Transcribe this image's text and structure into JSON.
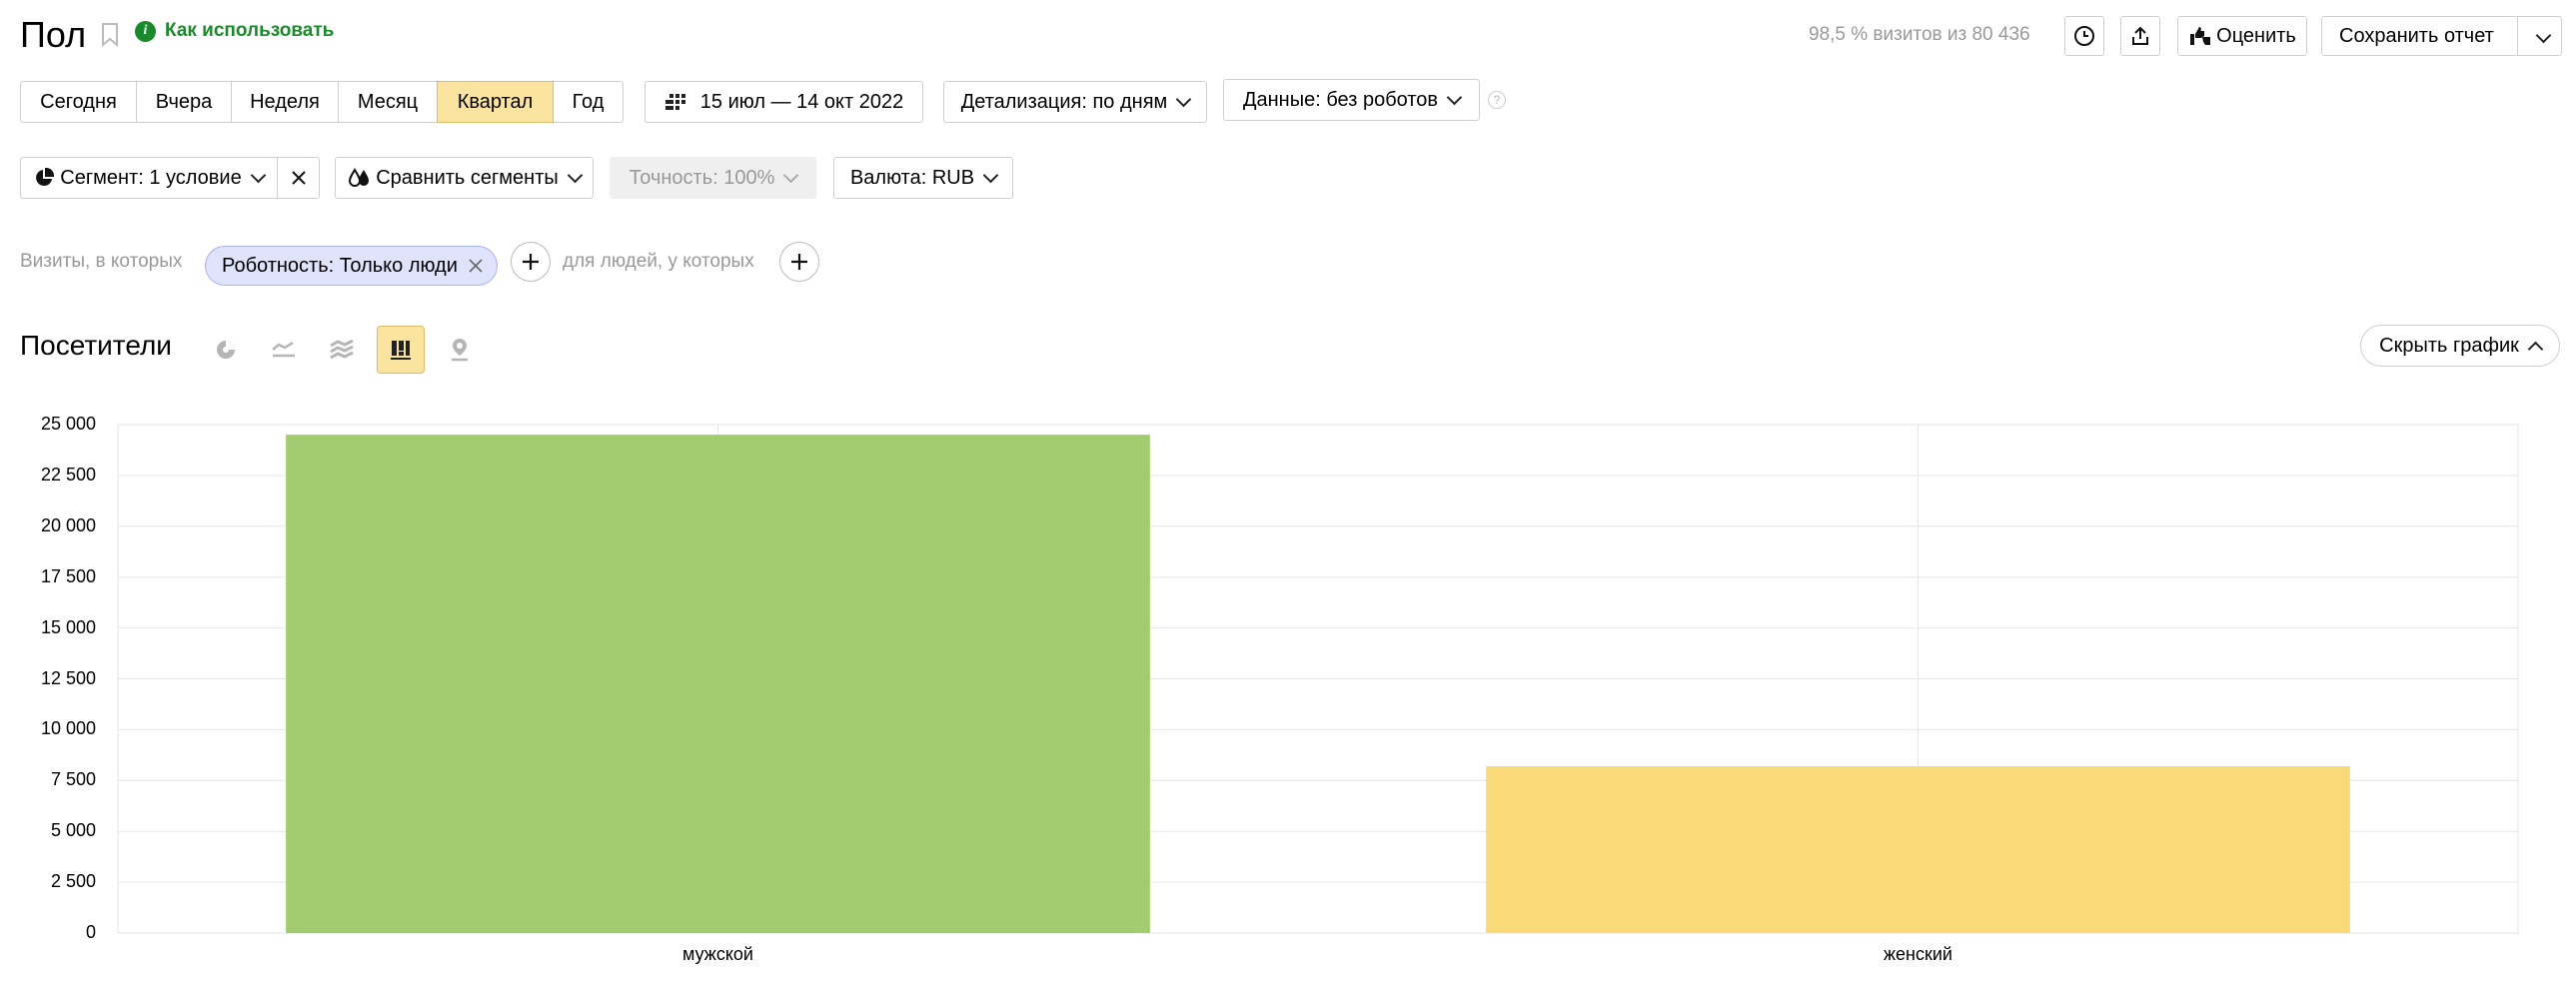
{
  "header": {
    "title": "Пол",
    "how_to_use": "Как использовать",
    "visits_info": "98,5 % визитов из 80 436",
    "rate_label": "Оценить",
    "save_report_label": "Сохранить отчет"
  },
  "periods": [
    "Сегодня",
    "Вчера",
    "Неделя",
    "Месяц",
    "Квартал",
    "Год"
  ],
  "active_period": "Квартал",
  "date_range": "15 июл — 14 окт 2022",
  "detail_label": "Детализация: по дням",
  "data_label": "Данные: без роботов",
  "segment_label": "Сегмент: 1 условие",
  "compare_label": "Сравнить сегменты",
  "accuracy_label": "Точность: 100%",
  "currency_label": "Валюта: RUB",
  "filter": {
    "prefix": "Визиты, в которых",
    "chip": "Роботность: Только люди",
    "people_label": "для людей, у которых"
  },
  "section_title": "Посетители",
  "hide_chart_label": "Скрыть график",
  "colors": {
    "male": "#a3cb6f",
    "female": "#f9d978",
    "active": "#fbe3a0",
    "link": "#1b8a2a"
  },
  "icons": [
    "info-icon",
    "bookmark-icon",
    "clock-icon",
    "share-icon",
    "thumbs-icon",
    "calendar-icon",
    "segment-pie-icon",
    "compare-drops-icon",
    "pie-view-icon",
    "line-view-icon",
    "area-view-icon",
    "bar-view-icon",
    "map-view-icon"
  ],
  "chart_data": {
    "type": "bar",
    "categories": [
      "мужской",
      "женский"
    ],
    "values": [
      24500,
      8200
    ],
    "ylim": [
      0,
      25000
    ],
    "yticks": [
      "0",
      "2 500",
      "5 000",
      "7 500",
      "10 000",
      "12 500",
      "15 000",
      "17 500",
      "20 000",
      "22 500",
      "25 000"
    ],
    "bar_colors": [
      "#a3cb6f",
      "#f9d978"
    ],
    "grid": true
  }
}
